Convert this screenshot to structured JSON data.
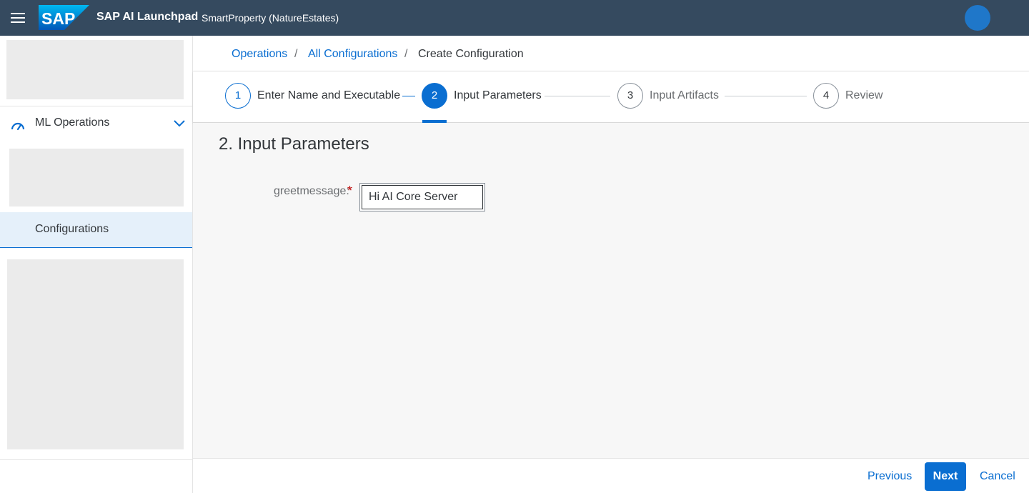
{
  "shell": {
    "logo_text": "SAP",
    "app_title": "SAP AI Launchpad",
    "subtitle": "SmartProperty (NatureEstates)",
    "colors": {
      "bar": "#354a5f",
      "avatar": "#1f77c9",
      "logo": "#0a8ed8"
    }
  },
  "sidebar": {
    "group_label": "ML Operations",
    "group_icon": "gauge-icon",
    "group_toggle_icon": "chevron-down-icon",
    "selected_item": "Configurations"
  },
  "breadcrumb": {
    "items": [
      "Operations",
      "All Configurations",
      "Create Configuration"
    ],
    "separator": "/"
  },
  "wizard": {
    "steps": [
      {
        "number": "1",
        "label": "Enter Name and Executable",
        "state": "done"
      },
      {
        "number": "2",
        "label": "Input Parameters",
        "state": "active"
      },
      {
        "number": "3",
        "label": "Input Artifacts",
        "state": "upcoming"
      },
      {
        "number": "4",
        "label": "Review",
        "state": "upcoming"
      }
    ],
    "accent": "#0a6ed1"
  },
  "content": {
    "section_title": "2. Input Parameters",
    "fields": [
      {
        "label": "greetmessage:",
        "required_marker": "*",
        "value": "Hi AI Core Server"
      }
    ]
  },
  "footer": {
    "previous_label": "Previous",
    "next_label": "Next",
    "cancel_label": "Cancel"
  }
}
